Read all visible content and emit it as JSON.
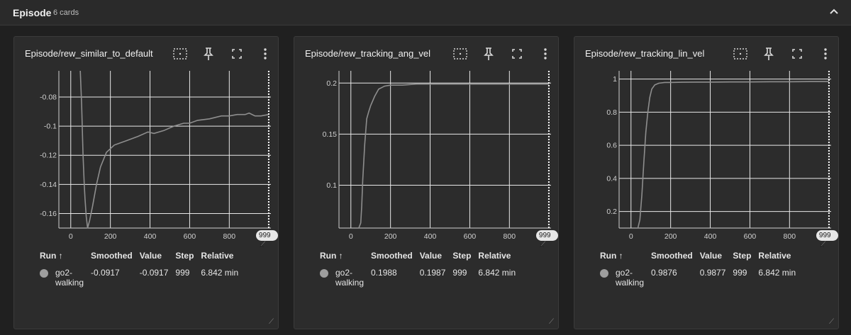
{
  "section": {
    "title": "Episode",
    "count_label": "6 cards"
  },
  "columns": [
    "Run ↑",
    "Smoothed",
    "Value",
    "Step",
    "Relative"
  ],
  "colors": {
    "line": "#8e8e8e",
    "grid": "#e8e8e8",
    "card": "#2c2c2c"
  },
  "icons": [
    "box-select-icon",
    "pin-icon",
    "fullscreen-icon",
    "more-vert-icon",
    "chevron-up-icon"
  ],
  "cards": [
    {
      "title": "Episode/rew_similar_to_default",
      "badge": "999 ✕",
      "row": {
        "run": "go2-walking",
        "run_l1": "go2-",
        "run_l2": "walking",
        "smoothed": "-0.0917",
        "value": "-0.0917",
        "step": "999",
        "relative": "6.842 min"
      }
    },
    {
      "title": "Episode/rew_tracking_ang_vel",
      "badge": "999 ✕",
      "row": {
        "run": "go2-walking",
        "run_l1": "go2-",
        "run_l2": "walking",
        "smoothed": "0.1988",
        "value": "0.1987",
        "step": "999",
        "relative": "6.842 min"
      }
    },
    {
      "title": "Episode/rew_tracking_lin_vel",
      "badge": "999 ✕",
      "row": {
        "run": "go2-walking",
        "run_l1": "go2-",
        "run_l2": "walking",
        "smoothed": "0.9876",
        "value": "0.9877",
        "step": "999",
        "relative": "6.842 min"
      }
    }
  ],
  "chart_data": [
    {
      "type": "line",
      "title": "Episode/rew_similar_to_default",
      "xlim": [
        -60,
        1010
      ],
      "ylim": [
        -0.17,
        -0.062
      ],
      "xticks": [
        0,
        200,
        400,
        600,
        800
      ],
      "yticks": [
        -0.08,
        -0.1,
        -0.12,
        -0.14,
        -0.16
      ],
      "ytick_labels": [
        "-0.08",
        "-0.1",
        "-0.12",
        "-0.14",
        "-0.16"
      ],
      "grid": true,
      "marker_x": 999,
      "series": [
        {
          "x": [
            48,
            55,
            62,
            68,
            72,
            78,
            85,
            95,
            110,
            130,
            150,
            180,
            220,
            280,
            340,
            390,
            420,
            470,
            520,
            570,
            600,
            640,
            700,
            760,
            800,
            840,
            880,
            900,
            930,
            960,
            999
          ],
          "y": [
            -0.06,
            -0.085,
            -0.12,
            -0.14,
            -0.15,
            -0.162,
            -0.17,
            -0.165,
            -0.155,
            -0.14,
            -0.128,
            -0.118,
            -0.113,
            -0.11,
            -0.107,
            -0.104,
            -0.105,
            -0.103,
            -0.1,
            -0.098,
            -0.098,
            -0.096,
            -0.095,
            -0.093,
            -0.093,
            -0.092,
            -0.092,
            -0.091,
            -0.093,
            -0.093,
            -0.092
          ]
        }
      ]
    },
    {
      "type": "line",
      "title": "Episode/rew_tracking_ang_vel",
      "xlim": [
        -60,
        1010
      ],
      "ylim": [
        0.058,
        0.212
      ],
      "xticks": [
        0,
        200,
        400,
        600,
        800
      ],
      "yticks": [
        0.1,
        0.15,
        0.2
      ],
      "ytick_labels": [
        "0.1",
        "0.15",
        "0.2"
      ],
      "grid": true,
      "marker_x": 999,
      "series": [
        {
          "x": [
            40,
            50,
            55,
            60,
            70,
            80,
            90,
            100,
            120,
            140,
            170,
            200,
            260,
            330,
            400,
            500,
            600,
            700,
            800,
            900,
            999
          ],
          "y": [
            0.058,
            0.063,
            0.08,
            0.105,
            0.14,
            0.165,
            0.172,
            0.178,
            0.187,
            0.194,
            0.197,
            0.198,
            0.198,
            0.199,
            0.199,
            0.199,
            0.199,
            0.199,
            0.199,
            0.199,
            0.199
          ]
        }
      ]
    },
    {
      "type": "line",
      "title": "Episode/rew_tracking_lin_vel",
      "xlim": [
        -60,
        1010
      ],
      "ylim": [
        0.1,
        1.05
      ],
      "xticks": [
        0,
        200,
        400,
        600,
        800
      ],
      "yticks": [
        0.2,
        0.4,
        0.6,
        0.8,
        1.0
      ],
      "ytick_labels": [
        "0.2",
        "0.4",
        "0.6",
        "0.8",
        "1"
      ],
      "grid": true,
      "marker_x": 999,
      "series": [
        {
          "x": [
            35,
            45,
            55,
            65,
            75,
            85,
            95,
            105,
            120,
            140,
            170,
            200,
            260,
            330,
            400,
            500,
            600,
            700,
            800,
            900,
            999
          ],
          "y": [
            0.1,
            0.15,
            0.3,
            0.5,
            0.68,
            0.8,
            0.89,
            0.94,
            0.965,
            0.975,
            0.98,
            0.98,
            0.981,
            0.982,
            0.982,
            0.983,
            0.983,
            0.984,
            0.984,
            0.985,
            0.985
          ]
        }
      ]
    }
  ]
}
